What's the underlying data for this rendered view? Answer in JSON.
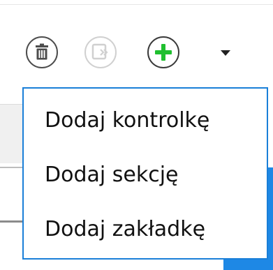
{
  "toolbar": {
    "buttons": [
      {
        "name": "delete",
        "icon": "trash-icon",
        "enabled": true
      },
      {
        "name": "import",
        "icon": "import-icon",
        "enabled": false
      },
      {
        "name": "add",
        "icon": "plus-icon",
        "enabled": true,
        "accent": "#1fbf2f"
      }
    ],
    "dropdown_icon": "caret-down-icon"
  },
  "menu": {
    "items": [
      {
        "label": "Dodaj kontrolkę"
      },
      {
        "label": "Dodaj sekcję"
      },
      {
        "label": "Dodaj zakładkę"
      }
    ]
  },
  "colors": {
    "menu_border": "#1a7fd8",
    "add_accent": "#1fbf2f",
    "disabled": "#d0d0d0"
  }
}
